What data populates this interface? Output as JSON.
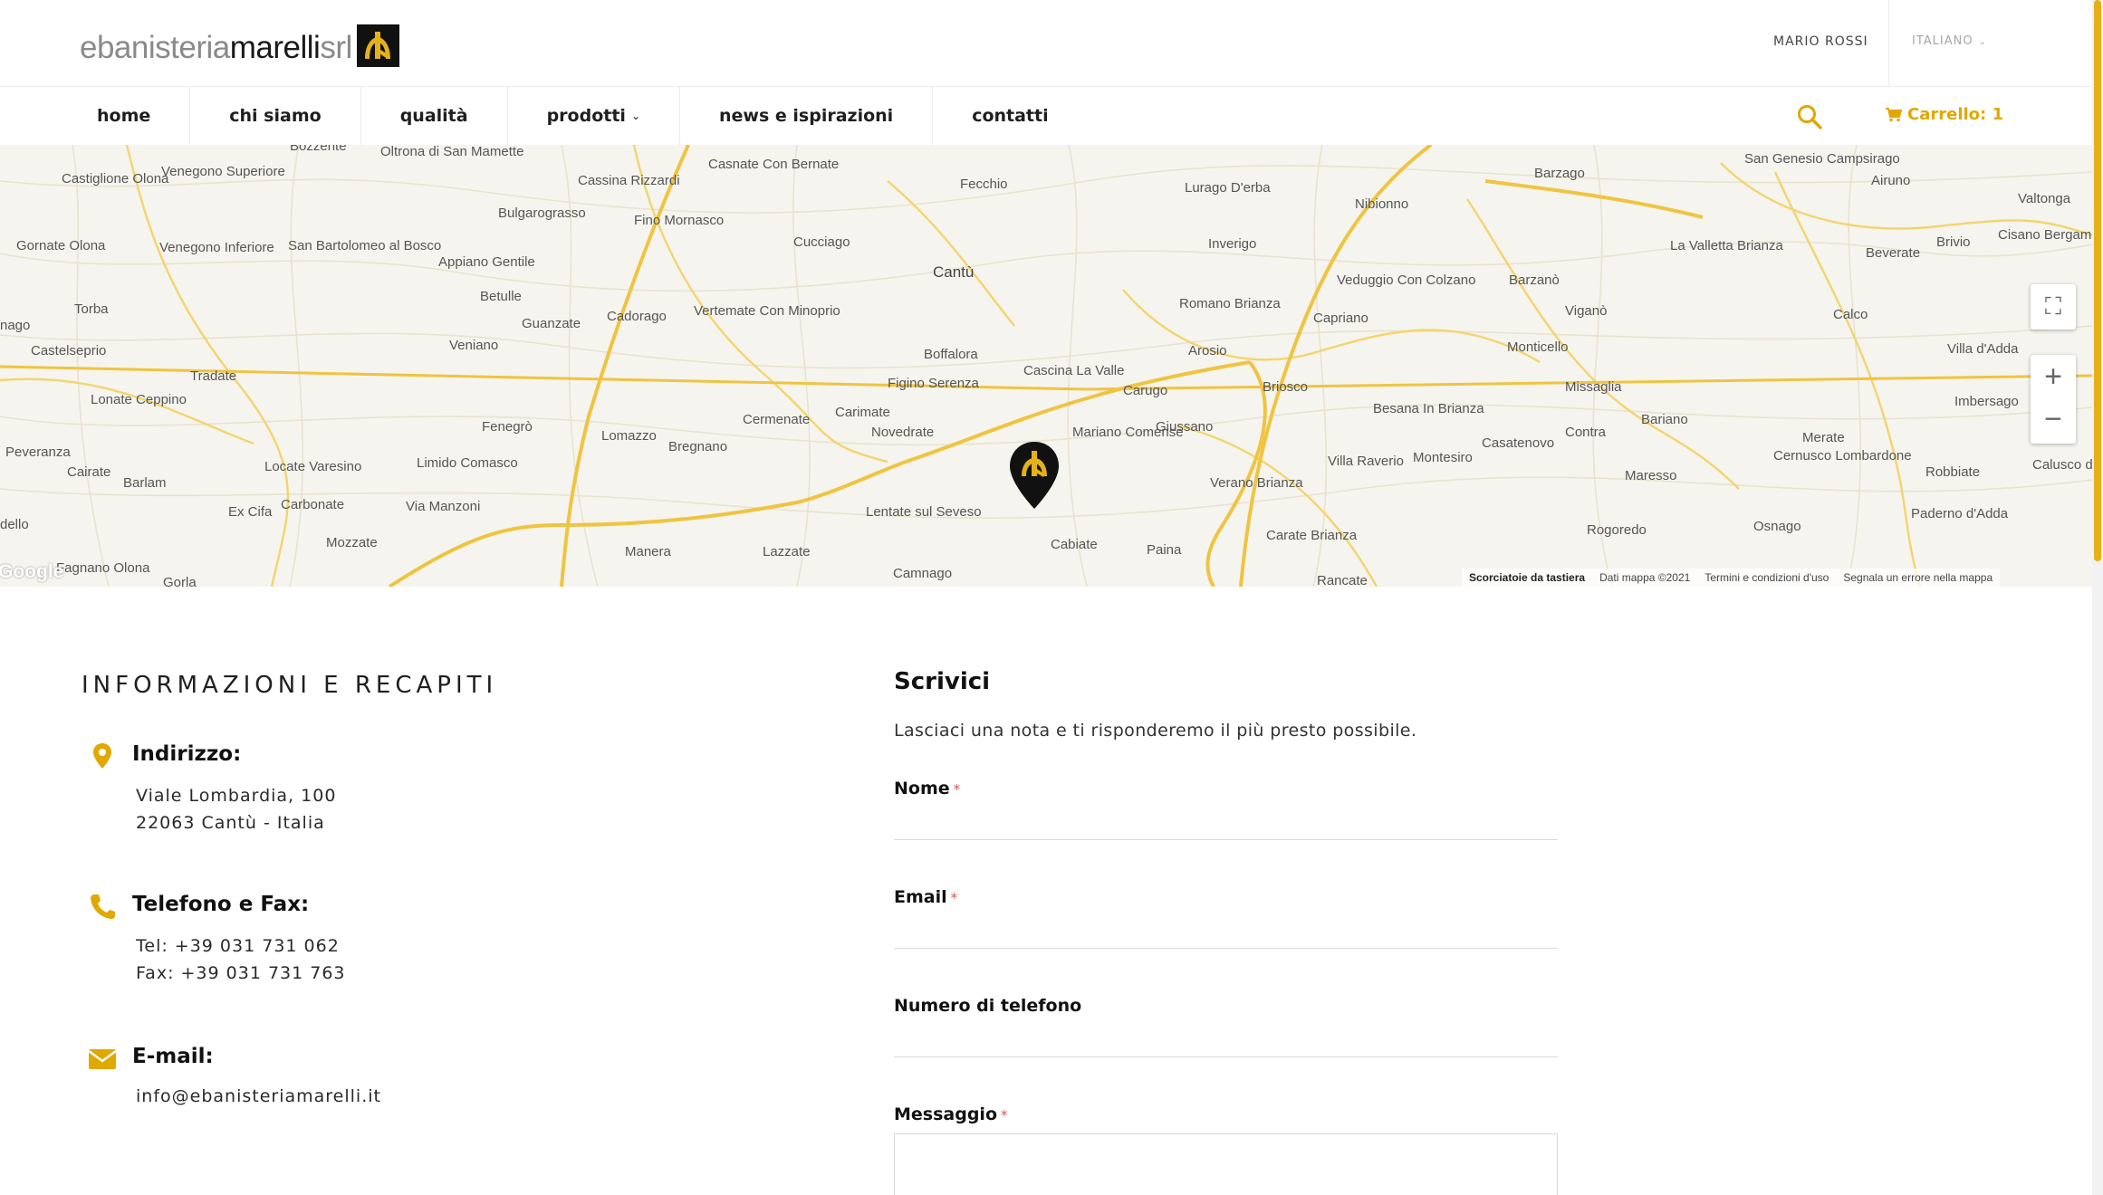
{
  "header": {
    "logo": {
      "light_text": "ebanisteria",
      "dark_text": "marelli",
      "suffix": "srl"
    },
    "user_name": "MARIO ROSSI",
    "language": "ITALIANO"
  },
  "nav": {
    "items": [
      {
        "label": "home"
      },
      {
        "label": "chi siamo"
      },
      {
        "label": "qualità"
      },
      {
        "label": "prodotti"
      },
      {
        "label": "news e ispirazioni"
      },
      {
        "label": "contatti"
      }
    ],
    "cart_label": "Carrello: 1"
  },
  "map": {
    "labels": [
      "Bozzente",
      "Oltrona di San Mamette",
      "Castiglione Olona",
      "Venegono Superiore",
      "Cassina Rizzardi",
      "Casnate Con Bernate",
      "Fecchio",
      "Lurago D'erba",
      "Nibionno",
      "Barzago",
      "San Genesio Campsirago",
      "Airuno",
      "Valtonga",
      "Bulgarograsso",
      "Fino Mornasco",
      "Cucciago",
      "Inverigo",
      "Veduggio Con Colzano",
      "Barzanò",
      "La Valletta Brianza",
      "Beverate",
      "Brivio",
      "Cisano Bergamasco",
      "Gornate Olona",
      "Venegono Inferiore",
      "San Bartolomeo al Bosco",
      "Appiano Gentile",
      "Cantù",
      "Romano Brianza",
      "Capriano",
      "Viganò",
      "Calco",
      "Torba",
      "Betulle",
      "Guanzate",
      "Cadorago",
      "Vertemate Con Minoprio",
      "Boffalora",
      "Arosio",
      "Monticello",
      "Villa d'Adda",
      "Castelseprio",
      "Veniano",
      "Figino Serenza",
      "Cascina La Valle",
      "Carugo",
      "Briosco",
      "Missaglia",
      "Imbersago",
      "Tradate",
      "Lonate Ceppino",
      "Fenegrò",
      "Lomazzo",
      "Cermenate",
      "Carimate",
      "Novedrate",
      "Mariano Comense",
      "Giussano",
      "Besana In Brianza",
      "Bariano",
      "Merate",
      "Bregnano",
      "Casatenovo",
      "Contra",
      "Peveranza",
      "Cairate",
      "Barlam",
      "Locate Varesino",
      "Limido Comasco",
      "Villa Raverio",
      "Montesiro",
      "Cernusco Lombardone",
      "Robbiate",
      "Calusco d'Adda",
      "Ex Cifa",
      "Carbonate",
      "Via Manzoni",
      "Verano Brianza",
      "Maresso",
      "Lentate sul Seveso",
      "Rogoredo",
      "Osnago",
      "Paderno d'Adda",
      "Mozzate",
      "Manera",
      "Lazzate",
      "Cabiate",
      "Paina",
      "Carate Brianza",
      "Fagnano Olona",
      "Gorla",
      "Camnago",
      "Rancate",
      "dello",
      "nago"
    ],
    "footer": {
      "shortcuts": "Scorciatoie da tastiera",
      "data": "Dati mappa ©2021",
      "terms": "Termini e condizioni d'uso",
      "report": "Segnala un errore nella mappa"
    },
    "google": "Google"
  },
  "info": {
    "title": "INFORMAZIONI E RECAPITI",
    "address": {
      "heading": "Indirizzo:",
      "line1": "Viale Lombardia, 100",
      "line2": "22063 Cantù - Italia"
    },
    "phone": {
      "heading": "Telefono e Fax:",
      "tel": "Tel: +39 031 731 062",
      "fax": "Fax: +39 031 731 763"
    },
    "email": {
      "heading": "E-mail:",
      "value": "info@ebanisteriamarelli.it"
    }
  },
  "form": {
    "title": "Scrivici",
    "intro": "Lasciaci una nota e ti risponderemo il più presto possibile.",
    "fields": [
      {
        "label": "Nome",
        "required": "*"
      },
      {
        "label": "Email",
        "required": "*"
      },
      {
        "label": "Numero di telefono",
        "required": ""
      },
      {
        "label": "Messaggio",
        "required": "*"
      }
    ]
  },
  "colors": {
    "accent": "#e0a800",
    "road": "#f0c640",
    "text": "#1f1f1f"
  }
}
